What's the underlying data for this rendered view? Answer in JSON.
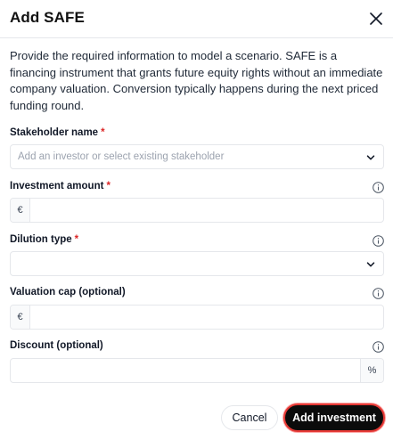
{
  "dialog": {
    "title": "Add SAFE",
    "description": "Provide the required information to model a scenario. SAFE is a financing instrument that grants future equity rights without an immediate company valuation. Conversion typically happens during the next priced funding round."
  },
  "fields": {
    "stakeholder": {
      "label": "Stakeholder name",
      "required_mark": "*",
      "placeholder": "Add an investor or select existing stakeholder"
    },
    "investment": {
      "label": "Investment amount",
      "required_mark": "*",
      "currency": "€",
      "value": ""
    },
    "dilution": {
      "label": "Dilution type",
      "required_mark": "*",
      "value": ""
    },
    "valuation_cap": {
      "label": "Valuation cap (optional)",
      "currency": "€",
      "value": ""
    },
    "discount": {
      "label": "Discount (optional)",
      "suffix": "%",
      "value": ""
    }
  },
  "buttons": {
    "cancel": "Cancel",
    "add": "Add investment"
  },
  "icons": {
    "close": "close-icon",
    "info": "info-icon",
    "chevron": "chevron-down-icon"
  },
  "colors": {
    "required": "#dc2626",
    "primary_button": "#0b0b0b",
    "focus_ring": "#e53935"
  }
}
